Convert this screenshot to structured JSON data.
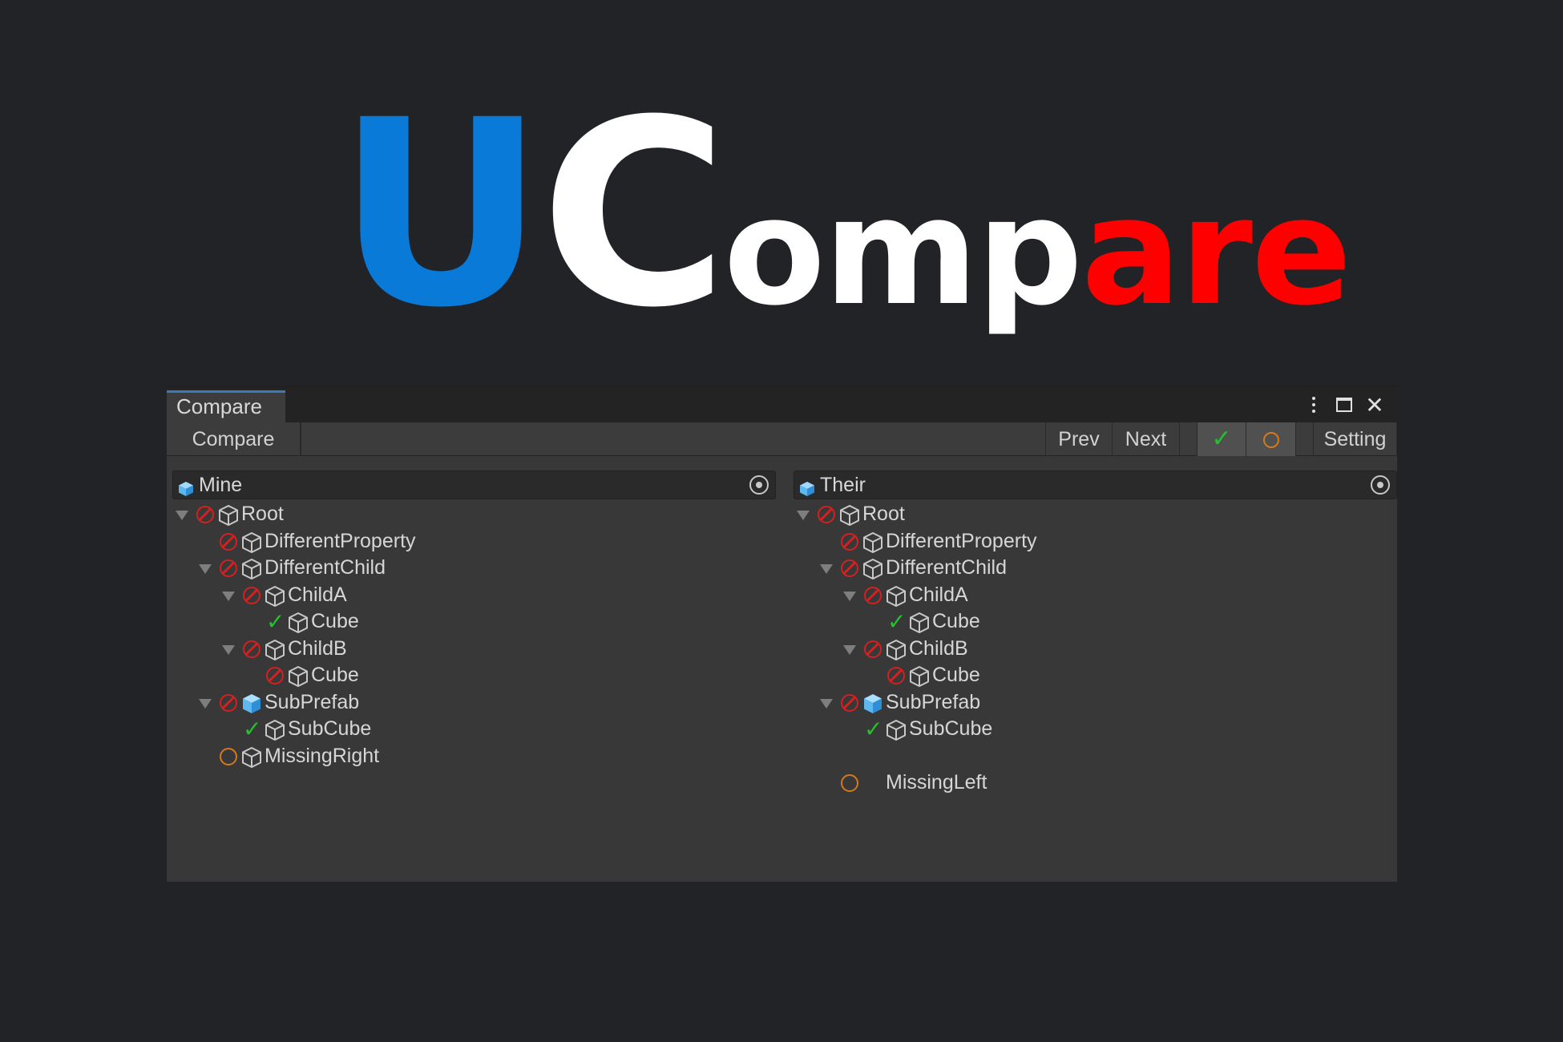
{
  "logo": {
    "letters": [
      {
        "text": "U",
        "color": "#0a7ad8",
        "size": "big"
      },
      {
        "text": "C",
        "color": "#ffffff",
        "size": "big"
      },
      {
        "text": "omp",
        "color": "#ffffff",
        "size": "small"
      },
      {
        "text": "ar",
        "color": "#ff0000",
        "size": "small"
      },
      {
        "text": "e",
        "color": "#ff0000",
        "size": "small"
      }
    ]
  },
  "window": {
    "tab_label": "Compare",
    "controls": [
      "more-options-icon",
      "maximize-icon",
      "close-icon"
    ]
  },
  "toolbar": {
    "compare_label": "Compare",
    "prev_label": "Prev",
    "next_label": "Next",
    "ok_filter_icon": "checkmark-icon",
    "missing_filter_icon": "circle-icon",
    "setting_label": "Setting"
  },
  "panes": {
    "left": {
      "field_label": "Mine",
      "rows": [
        {
          "label": "Root",
          "depth": 0,
          "arrow": true,
          "status": "diff",
          "icon": "gameobject"
        },
        {
          "label": "DifferentProperty",
          "depth": 1,
          "arrow": false,
          "status": "diff",
          "icon": "gameobject"
        },
        {
          "label": "DifferentChild",
          "depth": 1,
          "arrow": true,
          "status": "diff",
          "icon": "gameobject"
        },
        {
          "label": "ChildA",
          "depth": 2,
          "arrow": true,
          "status": "diff",
          "icon": "gameobject"
        },
        {
          "label": "Cube",
          "depth": 3,
          "arrow": false,
          "status": "ok",
          "icon": "gameobject"
        },
        {
          "label": "ChildB",
          "depth": 2,
          "arrow": true,
          "status": "diff",
          "icon": "gameobject"
        },
        {
          "label": "Cube",
          "depth": 3,
          "arrow": false,
          "status": "diff",
          "icon": "gameobject"
        },
        {
          "label": "SubPrefab",
          "depth": 1,
          "arrow": true,
          "status": "diff",
          "icon": "prefab"
        },
        {
          "label": "SubCube",
          "depth": 2,
          "arrow": false,
          "status": "ok",
          "icon": "gameobject"
        },
        {
          "label": "MissingRight",
          "depth": 1,
          "arrow": false,
          "status": "missing",
          "icon": "gameobject"
        }
      ]
    },
    "right": {
      "field_label": "Their",
      "rows": [
        {
          "label": "Root",
          "depth": 0,
          "arrow": true,
          "status": "diff",
          "icon": "gameobject"
        },
        {
          "label": "DifferentProperty",
          "depth": 1,
          "arrow": false,
          "status": "diff",
          "icon": "gameobject"
        },
        {
          "label": "DifferentChild",
          "depth": 1,
          "arrow": true,
          "status": "diff",
          "icon": "gameobject"
        },
        {
          "label": "ChildA",
          "depth": 2,
          "arrow": true,
          "status": "diff",
          "icon": "gameobject"
        },
        {
          "label": "Cube",
          "depth": 3,
          "arrow": false,
          "status": "ok",
          "icon": "gameobject"
        },
        {
          "label": "ChildB",
          "depth": 2,
          "arrow": true,
          "status": "diff",
          "icon": "gameobject"
        },
        {
          "label": "Cube",
          "depth": 3,
          "arrow": false,
          "status": "diff",
          "icon": "gameobject"
        },
        {
          "label": "SubPrefab",
          "depth": 1,
          "arrow": true,
          "status": "diff",
          "icon": "prefab"
        },
        {
          "label": "SubCube",
          "depth": 2,
          "arrow": false,
          "status": "ok",
          "icon": "gameobject"
        },
        {
          "label": "",
          "depth": 1,
          "arrow": false,
          "status": "none",
          "icon": "none"
        },
        {
          "label": "MissingLeft",
          "depth": 1,
          "arrow": false,
          "status": "missing",
          "icon": "none"
        }
      ]
    }
  },
  "colors": {
    "background": "#222327",
    "panel": "#383838",
    "diff_status": "#d42020",
    "ok_status": "#26c02e",
    "missing_status": "#d27a1c",
    "prefab_icon": "#5fb7f0"
  }
}
